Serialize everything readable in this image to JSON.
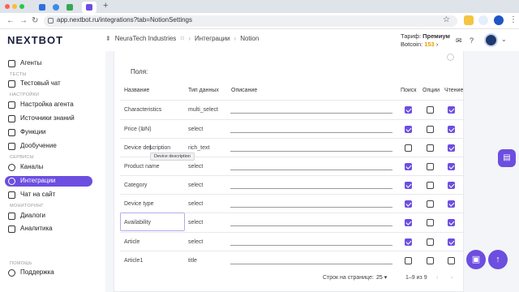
{
  "browser": {
    "url": "app.nextbot.ru/integrations?tab=NotionSettings",
    "new_tab": "+"
  },
  "header": {
    "logo": "NEXTBOT",
    "breadcrumb": [
      "NeuraTech Industries",
      "Интеграции",
      "Notion"
    ],
    "plan_label": "Тариф:",
    "plan_value": "Премиум",
    "coins_label": "Botcoin:",
    "coins_value": "153"
  },
  "sidebar": {
    "items_top": [
      {
        "label": "Агенты",
        "icon": "bot-icon"
      }
    ],
    "section_tests": "ТЕСТЫ",
    "items_tests": [
      {
        "label": "Тестовый чат",
        "icon": "chat-icon"
      }
    ],
    "section_settings": "НАСТРОЙКИ",
    "items_settings": [
      {
        "label": "Настройка агента",
        "icon": "sliders-icon"
      },
      {
        "label": "Источники знаний",
        "icon": "book-icon"
      },
      {
        "label": "Функции",
        "icon": "function-icon"
      },
      {
        "label": "Дообучение",
        "icon": "training-icon"
      }
    ],
    "section_services": "СЕРВИСЫ",
    "items_services": [
      {
        "label": "Каналы",
        "icon": "globe-icon"
      },
      {
        "label": "Интеграции",
        "icon": "share-icon",
        "active": true
      },
      {
        "label": "Чат на сайт",
        "icon": "site-chat-icon"
      }
    ],
    "section_monitoring": "МОНИТОРИНГ",
    "items_monitoring": [
      {
        "label": "Диалоги",
        "icon": "dialogs-icon"
      },
      {
        "label": "Аналитика",
        "icon": "analytics-icon"
      }
    ],
    "section_help": "ПОМОЩЬ",
    "items_help": [
      {
        "label": "Поддержка",
        "icon": "support-icon"
      }
    ]
  },
  "main": {
    "fields_label": "Поля:",
    "columns": [
      "Название",
      "Тип данных",
      "Описание",
      "Поиск",
      "Опции",
      "Чтение"
    ],
    "rows": [
      {
        "name": "Characteristics",
        "type": "multi_select",
        "search": true,
        "options": false,
        "read": true
      },
      {
        "name": "Price (₪N)",
        "type": "select",
        "search": true,
        "options": false,
        "read": true
      },
      {
        "name": "Device description",
        "type": "rich_text",
        "search": false,
        "options": false,
        "read": true
      },
      {
        "name": "Product name",
        "type": "select",
        "search": true,
        "options": false,
        "read": true
      },
      {
        "name": "Category",
        "type": "select",
        "search": true,
        "options": false,
        "read": true
      },
      {
        "name": "Device type",
        "type": "select",
        "search": true,
        "options": false,
        "read": true
      },
      {
        "name": "Availability",
        "type": "select",
        "search": true,
        "options": false,
        "read": true
      },
      {
        "name": "Article",
        "type": "select",
        "search": true,
        "options": false,
        "read": true
      },
      {
        "name": "Article1",
        "type": "title",
        "search": false,
        "options": false,
        "read": false
      }
    ],
    "tooltip": "Device description",
    "pager": {
      "rows_per_page_label": "Строк на странице:",
      "rows_per_page_value": "25",
      "range": "1–9 из 9"
    }
  },
  "colors": {
    "accent": "#6c4ee0",
    "coins": "#e6a100"
  }
}
